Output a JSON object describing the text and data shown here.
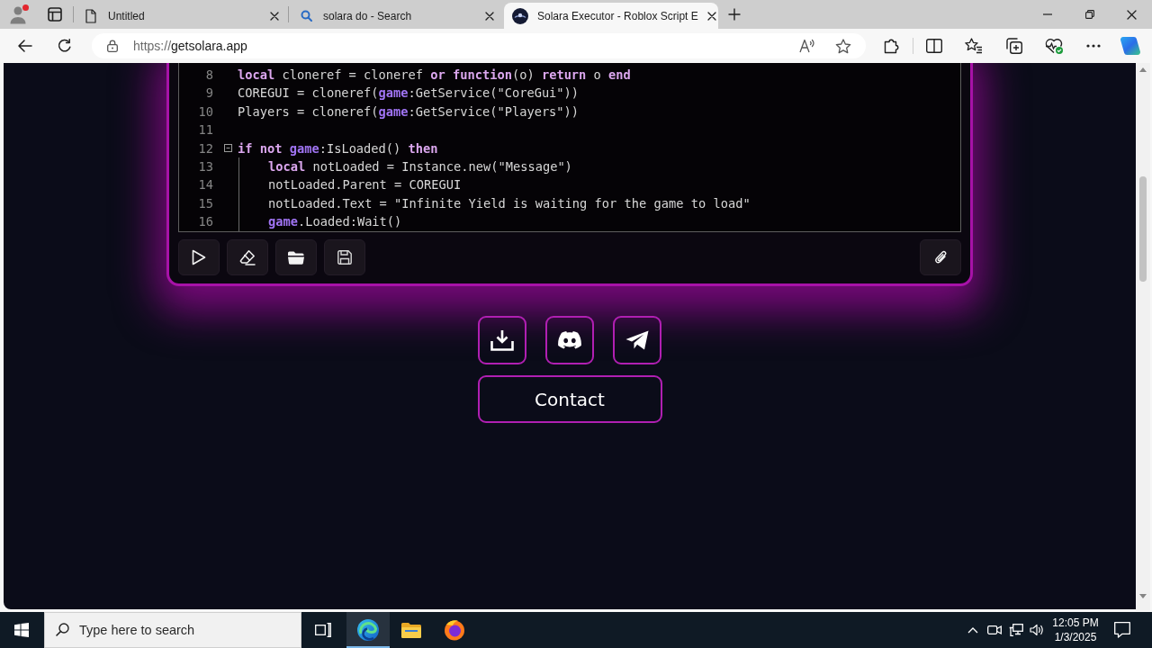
{
  "browser": {
    "tabs": [
      {
        "title": "Untitled",
        "selected": false
      },
      {
        "title": "solara do - Search",
        "selected": false
      },
      {
        "title": "Solara Executor - Roblox Script E",
        "selected": true
      }
    ],
    "address": {
      "scheme": "https://",
      "host": "getsolara.app"
    }
  },
  "editor": {
    "lines": [
      {
        "number": "8",
        "tokens": [
          {
            "text": "local",
            "kind": "keyword"
          },
          {
            "text": " cloneref = cloneref ",
            "kind": "plain"
          },
          {
            "text": "or ",
            "kind": "keyword"
          },
          {
            "text": "function",
            "kind": "keyword"
          },
          {
            "text": "(o) ",
            "kind": "plain"
          },
          {
            "text": "return",
            "kind": "keyword"
          },
          {
            "text": " o ",
            "kind": "plain"
          },
          {
            "text": "end",
            "kind": "keyword"
          }
        ]
      },
      {
        "number": "9",
        "tokens": [
          {
            "text": "COREGUI = cloneref(",
            "kind": "plain"
          },
          {
            "text": "game",
            "kind": "global"
          },
          {
            "text": ":GetService(\"CoreGui\"))",
            "kind": "plain"
          }
        ]
      },
      {
        "number": "10",
        "tokens": [
          {
            "text": "Players = cloneref(",
            "kind": "plain"
          },
          {
            "text": "game",
            "kind": "global"
          },
          {
            "text": ":GetService(\"Players\"))",
            "kind": "plain"
          }
        ]
      },
      {
        "number": "11"
      },
      {
        "number": "12",
        "expanded": true,
        "tokens": [
          {
            "text": "if ",
            "kind": "keyword"
          },
          {
            "text": "not ",
            "kind": "keyword"
          },
          {
            "text": "game",
            "kind": "global"
          },
          {
            "text": ":IsLoaded() ",
            "kind": "plain"
          },
          {
            "text": "then",
            "kind": "keyword"
          }
        ],
        "children": [
          {
            "number": "13",
            "tokens": [
              {
                "text": "local",
                "kind": "keyword"
              },
              {
                "text": " notLoaded = Instance.new(\"Message\")",
                "kind": "plain"
              }
            ]
          },
          {
            "number": "14",
            "tokens": [
              {
                "text": "notLoaded.Parent = COREGUI",
                "kind": "plain"
              }
            ]
          },
          {
            "number": "15",
            "tokens": [
              {
                "text": "notLoaded.Text = \"Infinite Yield is waiting for the game to load\"",
                "kind": "plain"
              }
            ]
          },
          {
            "number": "16",
            "tokens": [
              {
                "text": "game",
                "kind": "global"
              },
              {
                "text": ".Loaded:Wait()",
                "kind": "plain"
              }
            ]
          }
        ]
      }
    ]
  },
  "links": {
    "contact": "Contact"
  },
  "taskbar": {
    "search": {
      "placeholder": "Type here to search"
    },
    "apps": [
      {
        "selected": true
      },
      {
        "selected": false
      },
      {
        "selected": false
      }
    ],
    "time": "12:05 PM",
    "date": "1/3/2025"
  }
}
